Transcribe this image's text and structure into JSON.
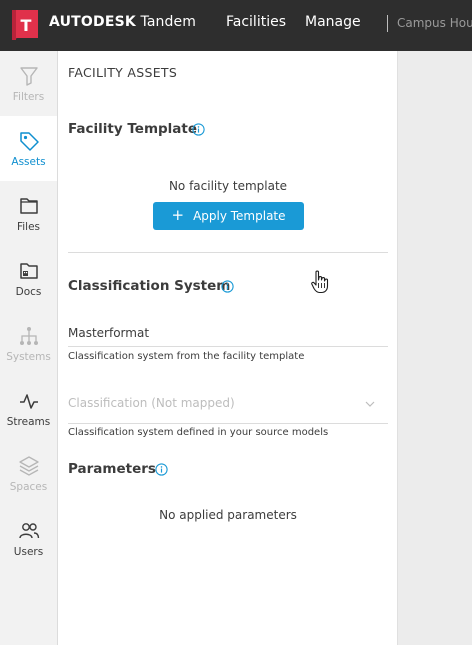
{
  "app": {
    "logo_letter": "T",
    "brand_bold": "AUTODESK",
    "brand_name": "Tandem",
    "nav": [
      "Facilities",
      "Manage"
    ],
    "breadcrumb": "Campus Hous",
    "colors": {
      "topbar": "#2e2e2e",
      "logo": "#e0314b",
      "accent": "#1a9ad6"
    }
  },
  "rail": {
    "items": [
      {
        "label": "Filters",
        "icon": "filter-icon",
        "state": "disabled"
      },
      {
        "label": "Assets",
        "icon": "tag-icon",
        "state": "active"
      },
      {
        "label": "Files",
        "icon": "folder-icon",
        "state": "normal"
      },
      {
        "label": "Docs",
        "icon": "docs-folder-icon",
        "state": "normal"
      },
      {
        "label": "Systems",
        "icon": "systems-icon",
        "state": "disabled"
      },
      {
        "label": "Streams",
        "icon": "pulse-icon",
        "state": "normal"
      },
      {
        "label": "Spaces",
        "icon": "layers-icon",
        "state": "disabled"
      },
      {
        "label": "Users",
        "icon": "users-icon",
        "state": "normal"
      }
    ]
  },
  "panel": {
    "title": "FACILITY ASSETS",
    "template": {
      "heading": "Facility Template",
      "empty_text": "No facility template",
      "apply_button": "Apply Template"
    },
    "classification": {
      "heading": "Classification System",
      "value": "Masterformat",
      "value_help": "Classification system from the facility template",
      "select_placeholder": "Classification (Not mapped)",
      "select_help": "Classification system defined in your source models"
    },
    "parameters": {
      "heading": "Parameters",
      "empty_text": "No applied parameters"
    }
  }
}
